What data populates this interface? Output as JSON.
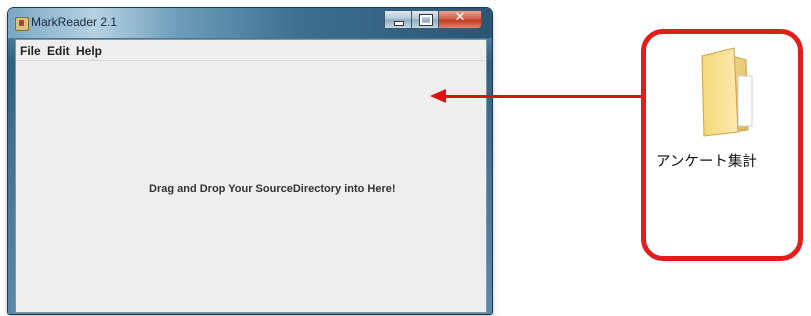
{
  "window": {
    "title": "MarkReader 2.1"
  },
  "menu": {
    "items": [
      "File",
      "Edit",
      "Help"
    ]
  },
  "main": {
    "drop_hint": "Drag and Drop Your SourceDirectory into Here!"
  },
  "folder": {
    "label": "アンケート集計"
  },
  "colors": {
    "accent_red": "#e01010",
    "client_bg": "#eeeeee"
  },
  "icons": [
    "java-app-icon",
    "minimize-icon",
    "maximize-icon",
    "close-icon",
    "folder-icon",
    "arrow-left-icon"
  ]
}
